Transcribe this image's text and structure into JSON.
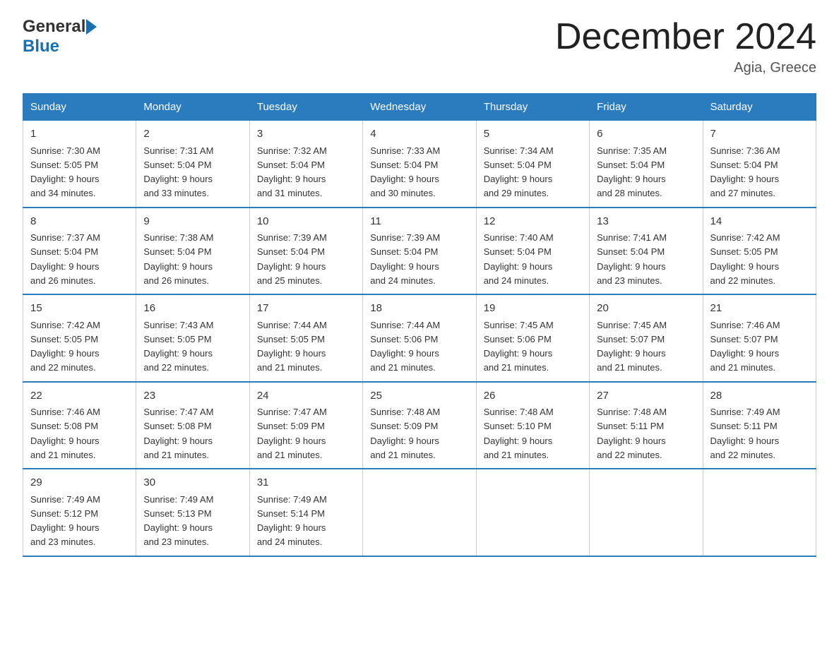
{
  "header": {
    "logo_general": "General",
    "logo_blue": "Blue",
    "title": "December 2024",
    "subtitle": "Agia, Greece"
  },
  "days_of_week": [
    "Sunday",
    "Monday",
    "Tuesday",
    "Wednesday",
    "Thursday",
    "Friday",
    "Saturday"
  ],
  "weeks": [
    [
      {
        "day": "1",
        "sunrise": "7:30 AM",
        "sunset": "5:05 PM",
        "daylight": "9 hours and 34 minutes."
      },
      {
        "day": "2",
        "sunrise": "7:31 AM",
        "sunset": "5:04 PM",
        "daylight": "9 hours and 33 minutes."
      },
      {
        "day": "3",
        "sunrise": "7:32 AM",
        "sunset": "5:04 PM",
        "daylight": "9 hours and 31 minutes."
      },
      {
        "day": "4",
        "sunrise": "7:33 AM",
        "sunset": "5:04 PM",
        "daylight": "9 hours and 30 minutes."
      },
      {
        "day": "5",
        "sunrise": "7:34 AM",
        "sunset": "5:04 PM",
        "daylight": "9 hours and 29 minutes."
      },
      {
        "day": "6",
        "sunrise": "7:35 AM",
        "sunset": "5:04 PM",
        "daylight": "9 hours and 28 minutes."
      },
      {
        "day": "7",
        "sunrise": "7:36 AM",
        "sunset": "5:04 PM",
        "daylight": "9 hours and 27 minutes."
      }
    ],
    [
      {
        "day": "8",
        "sunrise": "7:37 AM",
        "sunset": "5:04 PM",
        "daylight": "9 hours and 26 minutes."
      },
      {
        "day": "9",
        "sunrise": "7:38 AM",
        "sunset": "5:04 PM",
        "daylight": "9 hours and 26 minutes."
      },
      {
        "day": "10",
        "sunrise": "7:39 AM",
        "sunset": "5:04 PM",
        "daylight": "9 hours and 25 minutes."
      },
      {
        "day": "11",
        "sunrise": "7:39 AM",
        "sunset": "5:04 PM",
        "daylight": "9 hours and 24 minutes."
      },
      {
        "day": "12",
        "sunrise": "7:40 AM",
        "sunset": "5:04 PM",
        "daylight": "9 hours and 24 minutes."
      },
      {
        "day": "13",
        "sunrise": "7:41 AM",
        "sunset": "5:04 PM",
        "daylight": "9 hours and 23 minutes."
      },
      {
        "day": "14",
        "sunrise": "7:42 AM",
        "sunset": "5:05 PM",
        "daylight": "9 hours and 22 minutes."
      }
    ],
    [
      {
        "day": "15",
        "sunrise": "7:42 AM",
        "sunset": "5:05 PM",
        "daylight": "9 hours and 22 minutes."
      },
      {
        "day": "16",
        "sunrise": "7:43 AM",
        "sunset": "5:05 PM",
        "daylight": "9 hours and 22 minutes."
      },
      {
        "day": "17",
        "sunrise": "7:44 AM",
        "sunset": "5:05 PM",
        "daylight": "9 hours and 21 minutes."
      },
      {
        "day": "18",
        "sunrise": "7:44 AM",
        "sunset": "5:06 PM",
        "daylight": "9 hours and 21 minutes."
      },
      {
        "day": "19",
        "sunrise": "7:45 AM",
        "sunset": "5:06 PM",
        "daylight": "9 hours and 21 minutes."
      },
      {
        "day": "20",
        "sunrise": "7:45 AM",
        "sunset": "5:07 PM",
        "daylight": "9 hours and 21 minutes."
      },
      {
        "day": "21",
        "sunrise": "7:46 AM",
        "sunset": "5:07 PM",
        "daylight": "9 hours and 21 minutes."
      }
    ],
    [
      {
        "day": "22",
        "sunrise": "7:46 AM",
        "sunset": "5:08 PM",
        "daylight": "9 hours and 21 minutes."
      },
      {
        "day": "23",
        "sunrise": "7:47 AM",
        "sunset": "5:08 PM",
        "daylight": "9 hours and 21 minutes."
      },
      {
        "day": "24",
        "sunrise": "7:47 AM",
        "sunset": "5:09 PM",
        "daylight": "9 hours and 21 minutes."
      },
      {
        "day": "25",
        "sunrise": "7:48 AM",
        "sunset": "5:09 PM",
        "daylight": "9 hours and 21 minutes."
      },
      {
        "day": "26",
        "sunrise": "7:48 AM",
        "sunset": "5:10 PM",
        "daylight": "9 hours and 21 minutes."
      },
      {
        "day": "27",
        "sunrise": "7:48 AM",
        "sunset": "5:11 PM",
        "daylight": "9 hours and 22 minutes."
      },
      {
        "day": "28",
        "sunrise": "7:49 AM",
        "sunset": "5:11 PM",
        "daylight": "9 hours and 22 minutes."
      }
    ],
    [
      {
        "day": "29",
        "sunrise": "7:49 AM",
        "sunset": "5:12 PM",
        "daylight": "9 hours and 23 minutes."
      },
      {
        "day": "30",
        "sunrise": "7:49 AM",
        "sunset": "5:13 PM",
        "daylight": "9 hours and 23 minutes."
      },
      {
        "day": "31",
        "sunrise": "7:49 AM",
        "sunset": "5:14 PM",
        "daylight": "9 hours and 24 minutes."
      },
      null,
      null,
      null,
      null
    ]
  ],
  "labels": {
    "sunrise": "Sunrise:",
    "sunset": "Sunset:",
    "daylight": "Daylight:"
  }
}
